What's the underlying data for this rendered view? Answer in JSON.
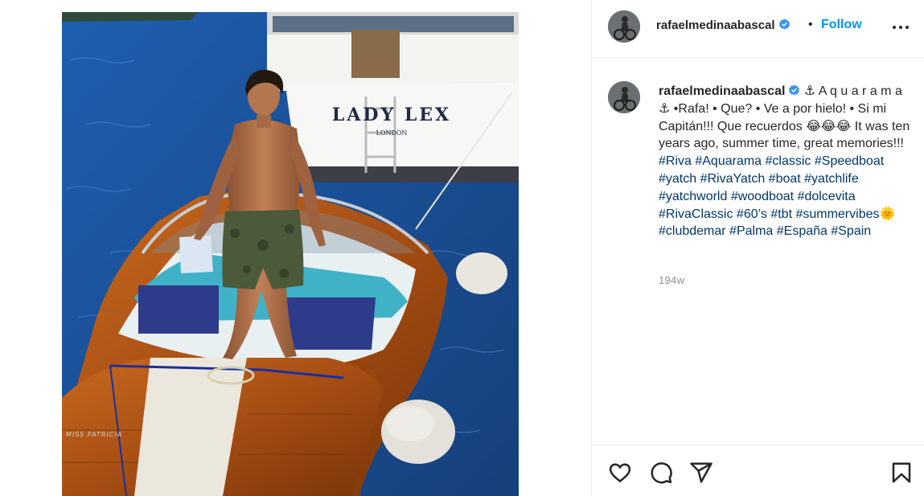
{
  "post": {
    "username": "rafaelmedinaabascal",
    "separator": "•",
    "follow_label": "Follow",
    "boat_name": "LADY LEX",
    "boat_port": "LONDON",
    "hull_name": "MISS PATRICIA",
    "caption_text": "⚓ A q u a r a m a ⚓ •Rafa! • Que? • Ve a por hielo! • Si mi Capitán!!! Que recuerdos 😂😂😂 It was ten years ago, summer time, great memories!!!",
    "hashtags_a": "#Riva #Aquarama #classic #Speedboat #yatch #RivaYatch #boat #yatchlife #yatchworld #woodboat #dolcevita #RivaClassic #60’s #tbt #summervibes",
    "sun_emoji": "🌞",
    "hashtags_b": "#clubdemar #Palma #España #Spain",
    "time_ago": "194w"
  },
  "icons": [
    "more-icon",
    "verified-icon",
    "heart-icon",
    "comment-icon",
    "share-icon",
    "bookmark-icon"
  ],
  "colors": {
    "follow": "#0095f6",
    "hashtag": "#00376b",
    "verified": "#3897f0",
    "muted": "#8e8e8e"
  }
}
